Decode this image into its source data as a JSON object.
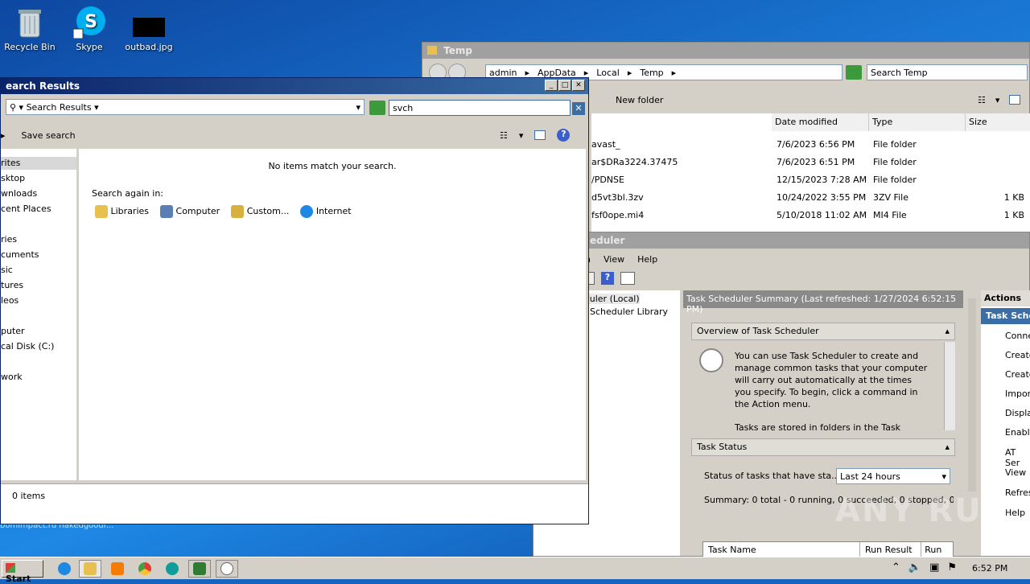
{
  "desktop": {
    "icons": [
      {
        "label": "Recycle Bin",
        "icon": "recycle-bin-icon"
      },
      {
        "label": "Skype",
        "icon": "skype-icon"
      },
      {
        "label": "outbad.jpg",
        "icon": "image-file-icon"
      }
    ],
    "bg_text": "bomimpact.ru   nakedgoodr..."
  },
  "temp_window": {
    "title": "Temp",
    "breadcrumb": [
      "admin",
      "AppData",
      "Local",
      "Temp"
    ],
    "search_placeholder": "Search Temp",
    "new_folder": "New folder",
    "columns": [
      "Date modified",
      "Type",
      "Size"
    ],
    "rows": [
      {
        "name": "avast_",
        "date": "7/6/2023 6:56 PM",
        "type": "File folder",
        "size": ""
      },
      {
        "name": "ar$DRa3224.37475",
        "date": "7/6/2023 6:51 PM",
        "type": "File folder",
        "size": ""
      },
      {
        "name": "/PDNSE",
        "date": "12/15/2023 7:28 AM",
        "type": "File folder",
        "size": ""
      },
      {
        "name": "d5vt3bl.3zv",
        "date": "10/24/2022 3:55 PM",
        "type": "3ZV File",
        "size": "1 KB"
      },
      {
        "name": "fsf0ope.mi4",
        "date": "5/10/2018 11:02 AM",
        "type": "MI4 File",
        "size": "1 KB"
      }
    ]
  },
  "scheduler": {
    "title": "eduler",
    "menu": [
      "n",
      "View",
      "Help"
    ],
    "tree": [
      "eduler (Local)",
      "Scheduler Library"
    ],
    "summary_title": "Task Scheduler Summary (Last refreshed: 1/27/2024 6:52:15 PM)",
    "overview_title": "Overview of Task Scheduler",
    "overview_text": "You can use Task Scheduler to create and manage common tasks that your computer will carry out automatically at the times you specify. To begin, click a command in the Action menu.",
    "overview_text2": "Tasks are stored in folders in the Task",
    "status_title": "Task Status",
    "status_label": "Status of tasks that have sta...",
    "status_select": "Last 24 hours",
    "summary_line": "Summary: 0 total - 0 running, 0 succeeded, 0 stopped, 0...",
    "table_cols": [
      "Task Name",
      "Run Result",
      "Run S"
    ],
    "actions_title": "Actions",
    "actions_sub": "Task Sche",
    "actions": [
      "Conne",
      "Create",
      "Create",
      "Import",
      "Display",
      "Enable",
      "AT Ser",
      "View",
      "Refres",
      "Help"
    ]
  },
  "search_window": {
    "title": "earch Results",
    "breadcrumb": "Search Results",
    "query": "svch",
    "save_search": "Save search",
    "nav": [
      "rites",
      "sktop",
      "wnloads",
      "cent Places",
      "ries",
      "cuments",
      "sic",
      "tures",
      "leos",
      "puter",
      "cal Disk (C:)",
      "work"
    ],
    "no_items": "No items match your search.",
    "search_again": "Search again in:",
    "locations": [
      "Libraries",
      "Computer",
      "Custom...",
      "Internet"
    ],
    "status": "0 items"
  },
  "taskbar": {
    "start": "Start",
    "clock": "6:52 PM"
  },
  "watermark": "ANY RUN"
}
